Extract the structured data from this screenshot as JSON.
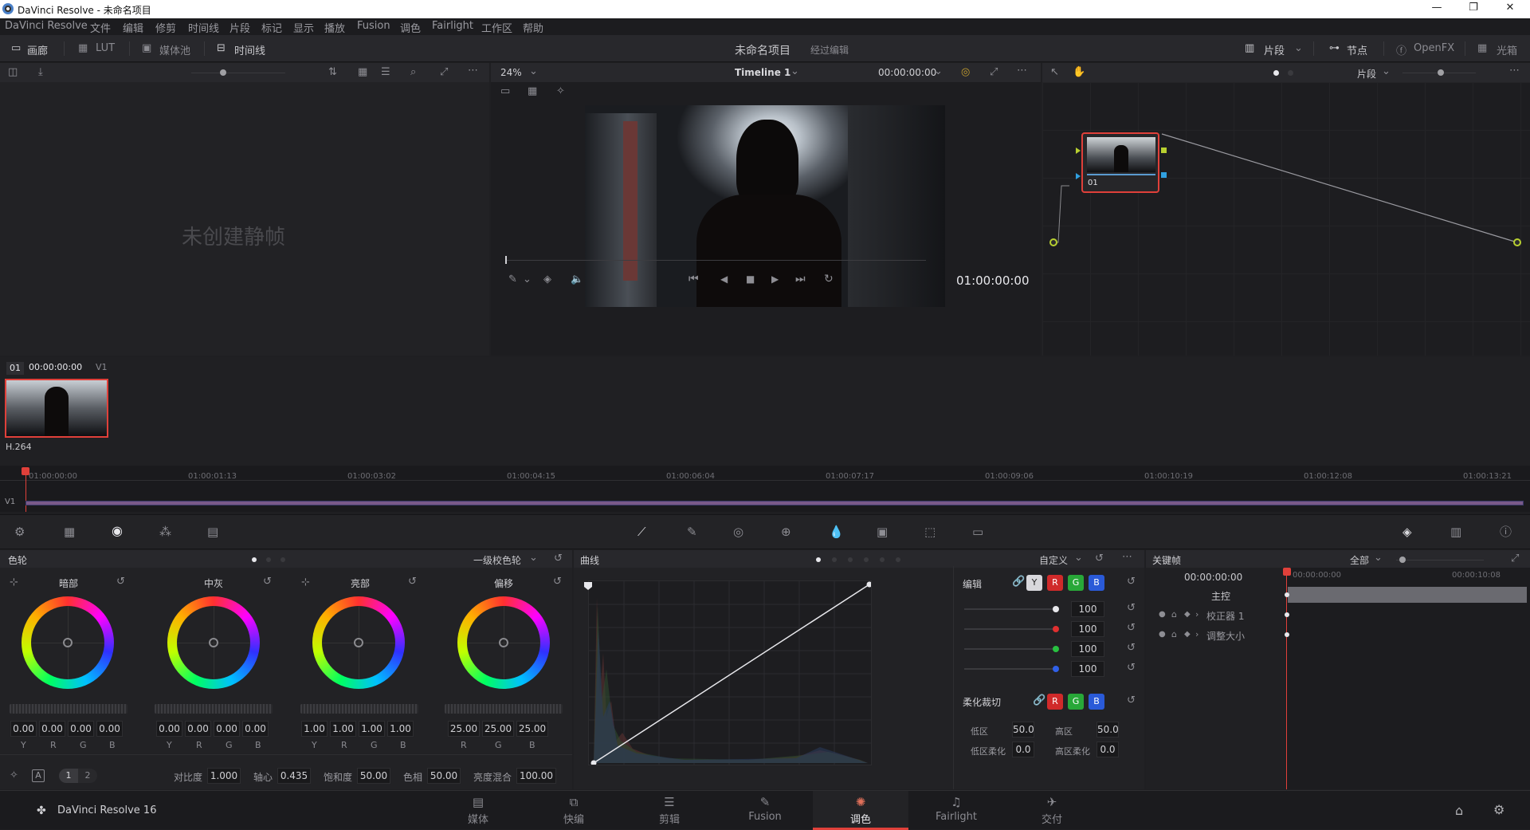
{
  "window": {
    "title": "DaVinci Resolve - 未命名项目",
    "minimize": "—",
    "restore": "❐",
    "close": "✕"
  },
  "menu": [
    "DaVinci Resolve",
    "文件",
    "编辑",
    "修剪",
    "时间线",
    "片段",
    "标记",
    "显示",
    "播放",
    "Fusion",
    "调色",
    "Fairlight",
    "工作区",
    "帮助"
  ],
  "toolbar": {
    "gallery": "画廊",
    "lut": "LUT",
    "media_pool": "媒体池",
    "timeline": "时间线",
    "project": "未命名项目",
    "edited": "经过编辑",
    "clips": "片段",
    "nodes": "节点",
    "openfx": "OpenFX",
    "lightbox": "光箱"
  },
  "gallery": {
    "empty_text": "未创建静帧"
  },
  "viewer": {
    "zoom": "24%",
    "timeline_name": "Timeline 1",
    "timecode_top": "00:00:00:00",
    "timecode": "01:00:00:00"
  },
  "nodes": {
    "clip_mode": "片段",
    "node_label": "01"
  },
  "clipstrip": {
    "clip_number": "01",
    "clip_timecode": "00:00:00:00",
    "track": "V1",
    "codec": "H.264"
  },
  "ruler": {
    "track": "V1",
    "ticks": [
      "01:00:00:00",
      "01:00:01:13",
      "01:00:03:02",
      "01:00:04:15",
      "01:00:06:04",
      "01:00:07:17",
      "01:00:09:06",
      "01:00:10:19",
      "01:00:12:08",
      "01:00:13:21"
    ]
  },
  "colorwheels": {
    "title": "色轮",
    "mode": "一级校色轮",
    "wheels": [
      {
        "name": "暗部",
        "values": [
          "0.00",
          "0.00",
          "0.00",
          "0.00"
        ],
        "labels": [
          "Y",
          "R",
          "G",
          "B"
        ]
      },
      {
        "name": "中灰",
        "values": [
          "0.00",
          "0.00",
          "0.00",
          "0.00"
        ],
        "labels": [
          "Y",
          "R",
          "G",
          "B"
        ]
      },
      {
        "name": "亮部",
        "values": [
          "1.00",
          "1.00",
          "1.00",
          "1.00"
        ],
        "labels": [
          "Y",
          "R",
          "G",
          "B"
        ]
      },
      {
        "name": "偏移",
        "values": [
          "25.00",
          "25.00",
          "25.00"
        ],
        "labels": [
          "R",
          "G",
          "B"
        ]
      }
    ],
    "page1": "1",
    "page2": "2",
    "params": [
      {
        "label": "对比度",
        "value": "1.000"
      },
      {
        "label": "轴心",
        "value": "0.435"
      },
      {
        "label": "饱和度",
        "value": "50.00"
      },
      {
        "label": "色相",
        "value": "50.00"
      },
      {
        "label": "亮度混合",
        "value": "100.00"
      }
    ]
  },
  "curves": {
    "title": "曲线",
    "mode": "自定义",
    "edit_label": "编辑",
    "channels": [
      "Y",
      "R",
      "G",
      "B"
    ],
    "intensities": [
      "100",
      "100",
      "100",
      "100"
    ],
    "soft_clip": {
      "title": "柔化裁切",
      "low": "低区",
      "low_val": "50.0",
      "high": "高区",
      "high_val": "50.0",
      "low_soft": "低区柔化",
      "low_soft_val": "0.0",
      "high_soft": "高区柔化",
      "high_soft_val": "0.0"
    }
  },
  "keyframes": {
    "title": "关键帧",
    "filter": "全部",
    "timecode": "00:00:00:00",
    "tc1": "00:00:00:00",
    "tc2": "00:00:10:08",
    "rows": [
      "主控",
      "校正器 1",
      "调整大小"
    ]
  },
  "bottomnav": {
    "app": "DaVinci Resolve 16",
    "pages": [
      "媒体",
      "快编",
      "剪辑",
      "Fusion",
      "调色",
      "Fairlight",
      "交付"
    ],
    "active": "调色"
  },
  "colors": {
    "accent": "#e0403a",
    "panel": "#222225",
    "toolbar": "#28282c"
  }
}
